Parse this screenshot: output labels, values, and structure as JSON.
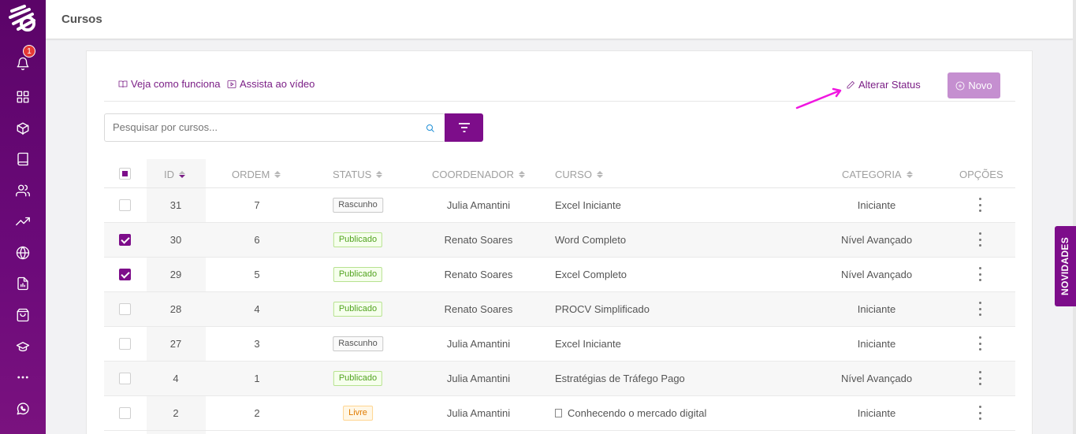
{
  "app": {
    "page_title": "Cursos",
    "accent_color": "#7d0d8a",
    "notification_count": "1"
  },
  "sidebar": {
    "items": [
      {
        "icon": "bell-icon"
      },
      {
        "icon": "dashboard-icon"
      },
      {
        "icon": "box-icon"
      },
      {
        "icon": "book-icon"
      },
      {
        "icon": "users-icon"
      },
      {
        "icon": "trending-icon"
      },
      {
        "icon": "globe-icon"
      },
      {
        "icon": "report-icon"
      },
      {
        "icon": "shopping-bag-icon"
      },
      {
        "icon": "graduation-cap-icon"
      },
      {
        "icon": "more-icon"
      },
      {
        "icon": "whatsapp-icon"
      }
    ]
  },
  "toolbar": {
    "how_it_works": "Veja como funciona",
    "watch_video": "Assista ao vídeo",
    "alter_status": "Alterar Status",
    "new_button": "Novo"
  },
  "search": {
    "placeholder": "Pesquisar por cursos..."
  },
  "table": {
    "columns": {
      "id": "ID",
      "ordem": "ORDEM",
      "status": "STATUS",
      "coordenador": "COORDENADOR",
      "curso": "CURSO",
      "categoria": "CATEGORIA",
      "opcoes": "OPÇÕES"
    },
    "rows": [
      {
        "checked": false,
        "id": "31",
        "ordem": "7",
        "status": "Rascunho",
        "status_type": "rascunho",
        "coordenador": "Julia Amantini",
        "curso": "Excel Iniciante",
        "categoria": "Iniciante"
      },
      {
        "checked": true,
        "id": "30",
        "ordem": "6",
        "status": "Publicado",
        "status_type": "publicado",
        "coordenador": "Renato Soares",
        "curso": "Word Completo",
        "categoria": "Nível Avançado"
      },
      {
        "checked": true,
        "id": "29",
        "ordem": "5",
        "status": "Publicado",
        "status_type": "publicado",
        "coordenador": "Renato Soares",
        "curso": "Excel Completo",
        "categoria": "Nível Avançado"
      },
      {
        "checked": false,
        "id": "28",
        "ordem": "4",
        "status": "Publicado",
        "status_type": "publicado",
        "coordenador": "Renato Soares",
        "curso": "PROCV Simplificado",
        "categoria": "Iniciante"
      },
      {
        "checked": false,
        "id": "27",
        "ordem": "3",
        "status": "Rascunho",
        "status_type": "rascunho",
        "coordenador": "Julia Amantini",
        "curso": "Excel Iniciante",
        "categoria": "Iniciante"
      },
      {
        "checked": false,
        "id": "4",
        "ordem": "1",
        "status": "Publicado",
        "status_type": "publicado",
        "coordenador": "Julia Amantini",
        "curso": "Estratégias de Tráfego Pago",
        "categoria": "Nível Avançado"
      },
      {
        "checked": false,
        "id": "2",
        "ordem": "2",
        "status": "Livre",
        "status_type": "livre",
        "coordenador": "Julia Amantini",
        "curso": "Conhecendo o mercado digital",
        "categoria": "Iniciante",
        "has_doc_icon": true
      }
    ]
  },
  "novidades_tab": "NOVIDADES"
}
